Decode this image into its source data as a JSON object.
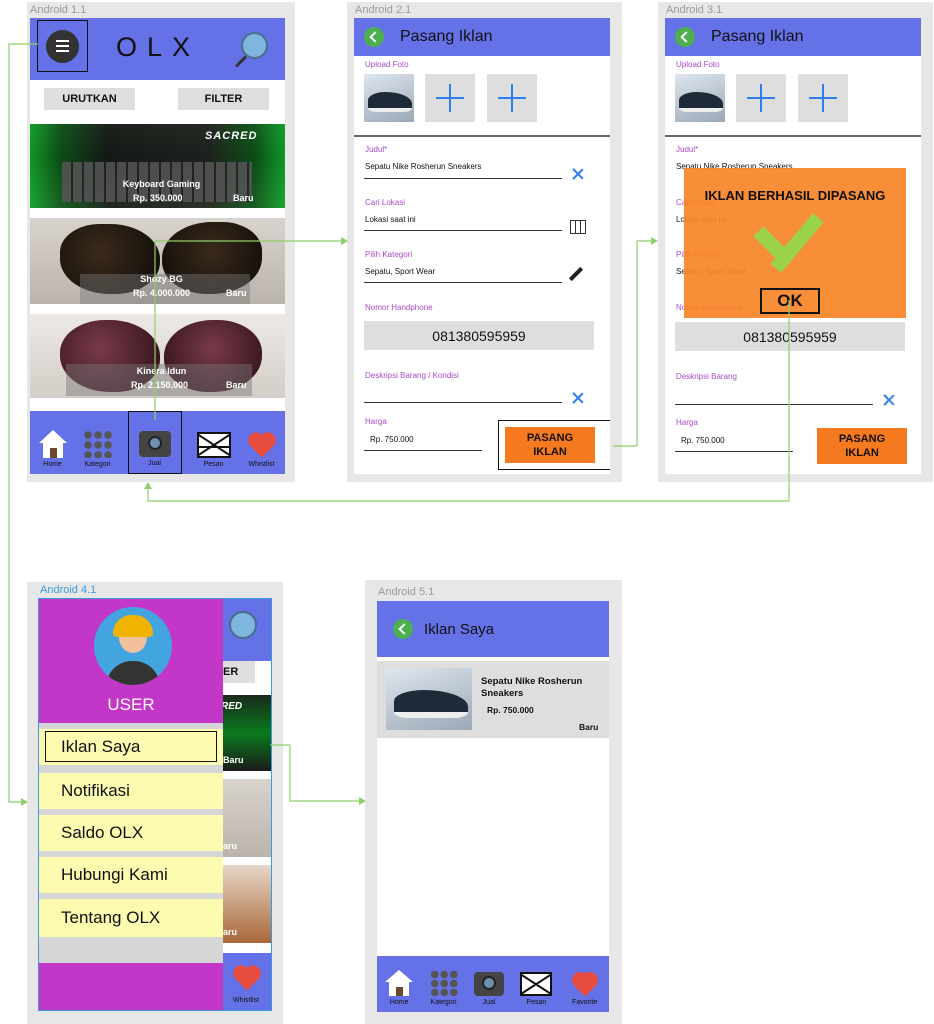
{
  "artboards": {
    "a1": "Android 1.1",
    "a2": "Android 2.1",
    "a3": "Android 3.1",
    "a4": "Android 4.1",
    "a5": "Android 5.1"
  },
  "home": {
    "logo": "OLX",
    "sort_label": "URUTKAN",
    "filter_label": "FILTER",
    "products": [
      {
        "title": "Keyboard Gaming",
        "price": "Rp. 350.000",
        "badge": "Baru"
      },
      {
        "title": "Shozy BG",
        "price": "Rp. 4.000.000",
        "badge": "Baru"
      },
      {
        "title": "Kinera Idun",
        "price": "Rp. 2.150.000",
        "badge": "Baru"
      }
    ],
    "keyboard_brand": "SACRED"
  },
  "nav": {
    "home": "Home",
    "kategori": "Kategori",
    "jual": "Jual",
    "pesan": "Pesan",
    "whistlist": "Whistlist",
    "favorite": "Favorite"
  },
  "post_ad": {
    "title": "Pasang Iklan",
    "upload_label": "Upload Foto",
    "judul_label": "Judul*",
    "judul_value": "Sepatu Nike Rosherun Sneakers",
    "lokasi_label": "Cari Lokasi",
    "lokasi_value": "Lokasi saat ini",
    "kategori_label": "Pilih Kategori",
    "kategori_value": "Sepatu, Sport Wear",
    "phone_label": "Nomor Handphone",
    "phone_value": "081380595959",
    "desc_label_1": "Deskripsi Barang / Kondisi",
    "desc_label_2": "Deskripsi Barang",
    "harga_label": "Harga",
    "harga_value": "Rp. 750.000",
    "submit_label": "PASANG IKLAN"
  },
  "dialog": {
    "message": "IKLAN BERHASIL DIPASANG",
    "ok_label": "OK"
  },
  "drawer": {
    "user_label": "USER",
    "items": [
      "Iklan Saya",
      "Notifikasi",
      "Saldo OLX",
      "Hubungi Kami",
      "Tentang OLX"
    ],
    "peek_filter_tail": "ER",
    "peek_brand": "RED",
    "peek_badge": "Baru",
    "peek_badge_2": "aru",
    "peek_badge_3": "aru"
  },
  "my_ads": {
    "title": "Iklan Saya",
    "item_title": "Sepatu Nike Rosherun Sneakers",
    "item_price": "Rp. 750.000",
    "item_badge": "Baru"
  },
  "colors": {
    "topbar": "#6571e6",
    "accent_orange": "#f5791f",
    "drawer_purple": "#c236c8",
    "menu_yellow": "#fdfbb0",
    "connector_green": "#8fd06b",
    "label_purple": "#a84ac8",
    "icon_blue": "#2d7ff0"
  }
}
